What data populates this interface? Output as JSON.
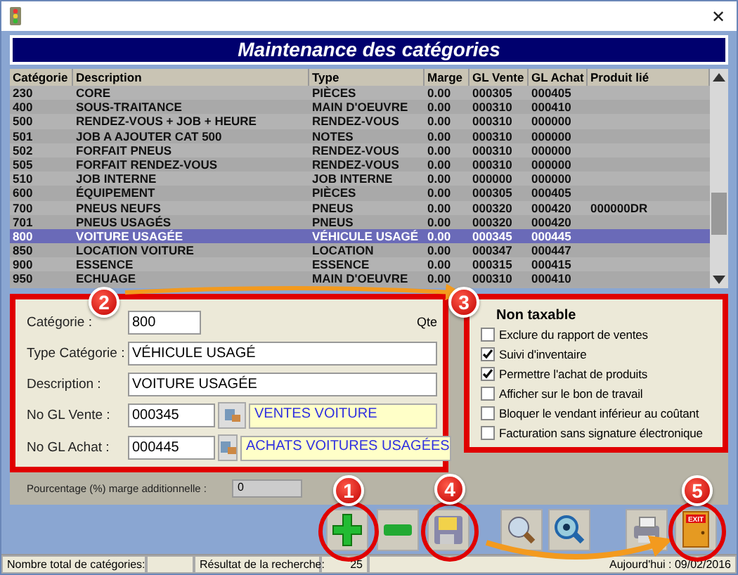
{
  "window": {
    "title_close": "✕"
  },
  "banner": {
    "title": "Maintenance des catégories"
  },
  "table": {
    "columns": [
      "Catégorie",
      "Description",
      "Type",
      "Marge",
      "GL Vente",
      "GL Achat",
      "Produit lié"
    ],
    "rows": [
      {
        "cells": [
          "230",
          "CORE",
          "PIÈCES",
          "0.00",
          "000305",
          "000405",
          ""
        ],
        "selected": false
      },
      {
        "cells": [
          "400",
          "SOUS-TRAITANCE",
          "MAIN D'OEUVRE",
          "0.00",
          "000310",
          "000410",
          ""
        ],
        "selected": false
      },
      {
        "cells": [
          "500",
          "RENDEZ-VOUS + JOB + HEURE",
          "RENDEZ-VOUS",
          "0.00",
          "000310",
          "000000",
          ""
        ],
        "selected": false
      },
      {
        "cells": [
          "501",
          "JOB A AJOUTER CAT 500",
          "NOTES",
          "0.00",
          "000310",
          "000000",
          ""
        ],
        "selected": false
      },
      {
        "cells": [
          "502",
          "FORFAIT PNEUS",
          "RENDEZ-VOUS",
          "0.00",
          "000310",
          "000000",
          ""
        ],
        "selected": false
      },
      {
        "cells": [
          "505",
          "FORFAIT RENDEZ-VOUS",
          "RENDEZ-VOUS",
          "0.00",
          "000310",
          "000000",
          ""
        ],
        "selected": false
      },
      {
        "cells": [
          "510",
          "JOB INTERNE",
          "JOB INTERNE",
          "0.00",
          "000000",
          "000000",
          ""
        ],
        "selected": false
      },
      {
        "cells": [
          "600",
          "ÉQUIPEMENT",
          "PIÈCES",
          "0.00",
          "000305",
          "000405",
          ""
        ],
        "selected": false
      },
      {
        "cells": [
          "700",
          "PNEUS NEUFS",
          "PNEUS",
          "0.00",
          "000320",
          "000420",
          "000000DR"
        ],
        "selected": false
      },
      {
        "cells": [
          "701",
          "PNEUS USAGÉS",
          "PNEUS",
          "0.00",
          "000320",
          "000420",
          ""
        ],
        "selected": false
      },
      {
        "cells": [
          "800",
          "VOITURE USAGÉE",
          "VÉHICULE USAGÉ",
          "0.00",
          "000345",
          "000445",
          ""
        ],
        "selected": true
      },
      {
        "cells": [
          "850",
          "LOCATION VOITURE",
          "LOCATION",
          "0.00",
          "000347",
          "000447",
          ""
        ],
        "selected": false
      },
      {
        "cells": [
          "900",
          "ESSENCE",
          "ESSENCE",
          "0.00",
          "000315",
          "000415",
          ""
        ],
        "selected": false
      },
      {
        "cells": [
          "950",
          "ECHUAGE",
          "MAIN D'OEUVRE",
          "0.00",
          "000310",
          "000410",
          ""
        ],
        "selected": false
      }
    ]
  },
  "form": {
    "categorie_label": "Catégorie :",
    "categorie_value": "800",
    "qte_label": "Qte",
    "type_label": "Type Catégorie :",
    "type_value": "VÉHICULE USAGÉ",
    "description_label": "Description :",
    "description_value": "VOITURE USAGÉE",
    "gl_vente_label": "No GL Vente :",
    "gl_vente_value": "000345",
    "gl_vente_name": "VENTES VOITURE",
    "gl_achat_label": "No GL Achat :",
    "gl_achat_value": "000445",
    "gl_achat_name": "ACHATS VOITURES USAGÉES",
    "marge_label": "Pourcentage (%) marge additionnelle :",
    "marge_value": "0"
  },
  "options": {
    "heading": "Non taxable",
    "items": [
      {
        "label": "Exclure du rapport de ventes",
        "checked": false
      },
      {
        "label": "Suivi d'inventaire",
        "checked": true
      },
      {
        "label": "Permettre l'achat de produits",
        "checked": true
      },
      {
        "label": "Afficher sur le bon de travail",
        "checked": false
      },
      {
        "label": "Bloquer le vendant inférieur au coûtant",
        "checked": false
      },
      {
        "label": "Facturation sans signature électronique",
        "checked": false
      }
    ]
  },
  "toolbar": [
    {
      "kind": "add"
    },
    {
      "kind": "remove"
    },
    {
      "kind": "save"
    },
    {
      "kind": "search"
    },
    {
      "kind": "view"
    },
    {
      "kind": "print"
    },
    {
      "kind": "exit",
      "label": "EXIT"
    }
  ],
  "annotations": [
    "1",
    "2",
    "3",
    "4",
    "5"
  ],
  "status_bar": {
    "total_label": "Nombre total de catégories:",
    "result_label": "Résultat de la recherche:",
    "result_value": "25",
    "today": "Aujourd'hui : 09/02/2016"
  }
}
